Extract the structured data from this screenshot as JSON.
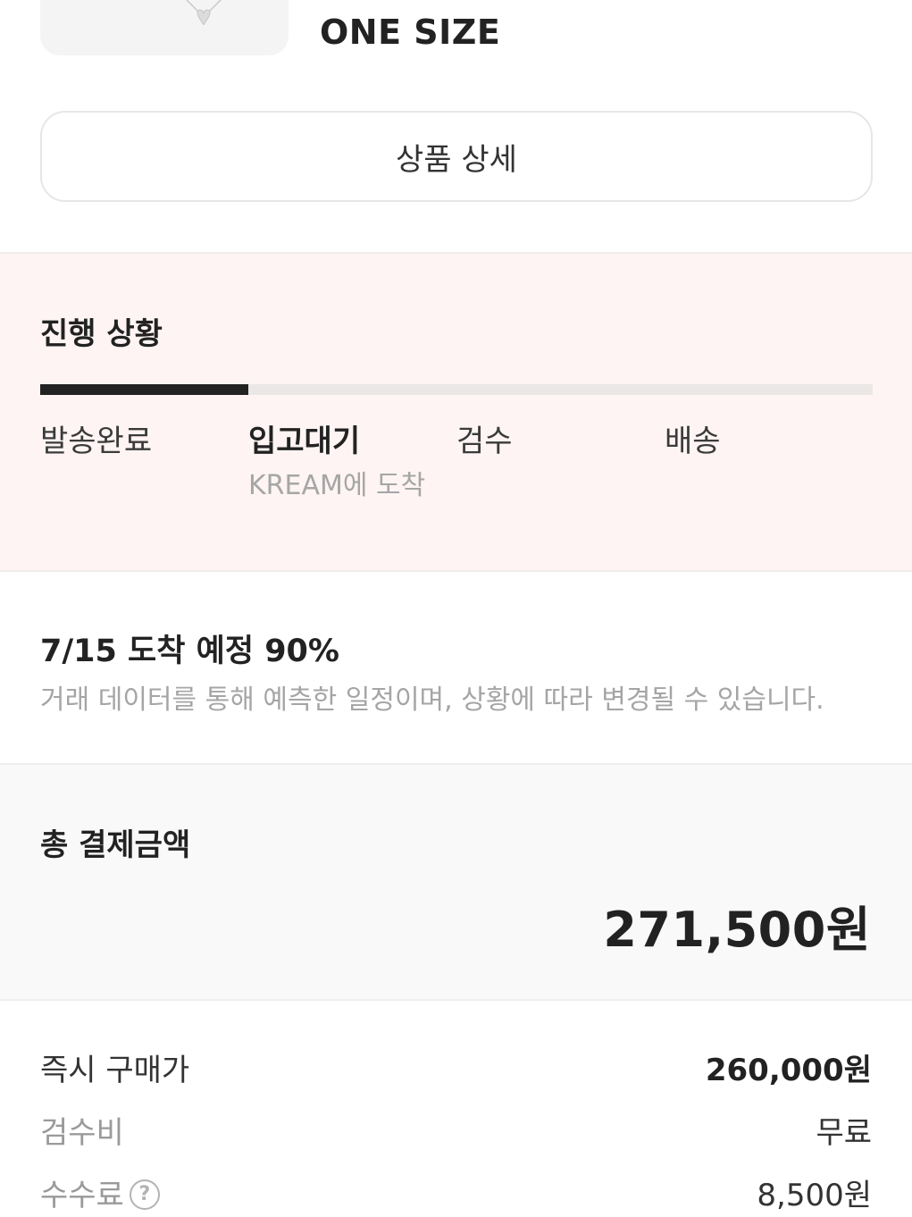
{
  "product": {
    "size": "ONE SIZE",
    "thumbnail_icon": "necklace-pendant-icon"
  },
  "detail_button": {
    "label": "상품 상세"
  },
  "progress": {
    "title": "진행 상황",
    "fraction": 0.25,
    "steps": [
      {
        "label": "발송완료",
        "active": false
      },
      {
        "label": "입고대기",
        "active": true,
        "sub": "KREAM에 도착"
      },
      {
        "label": "검수",
        "active": false
      },
      {
        "label": "배송",
        "active": false
      }
    ]
  },
  "arrival": {
    "headline": "7/15 도착 예정 90%",
    "description": "거래 데이터를 통해 예측한 일정이며, 상황에 따라 변경될 수 있습니다."
  },
  "total": {
    "label": "총 결제금액",
    "amount": "271,500원"
  },
  "price_rows": [
    {
      "label": "즉시 구매가",
      "value": "260,000원"
    },
    {
      "label": "검수비",
      "value": "무료"
    },
    {
      "label": "수수료",
      "value": "8,500원",
      "help_icon": "question-circle-icon",
      "help_glyph": "?"
    }
  ],
  "colors": {
    "progress_bg": "#fdf4f3",
    "progress_fill": "#222222",
    "progress_track": "#ebe7e6",
    "total_bg": "#f9f9f9"
  }
}
